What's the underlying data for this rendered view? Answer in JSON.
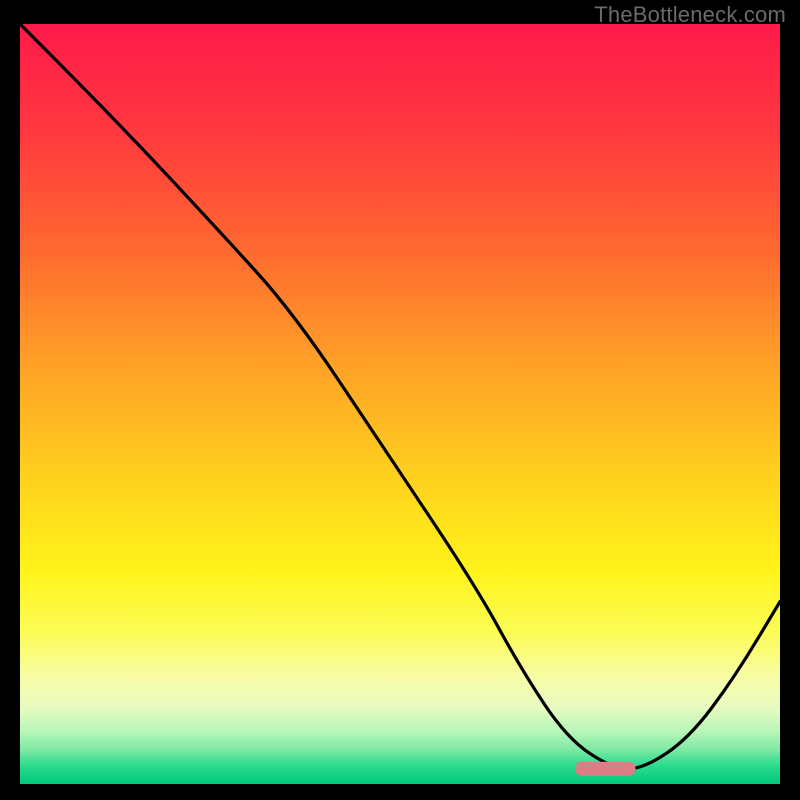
{
  "watermark": "TheBottleneck.com",
  "chart_data": {
    "type": "line",
    "title": "",
    "xlabel": "",
    "ylabel": "",
    "xlim": [
      0,
      100
    ],
    "ylim": [
      0,
      100
    ],
    "grid": false,
    "legend": false,
    "series": [
      {
        "name": "curve",
        "x": [
          0,
          12,
          26,
          36,
          48,
          60,
          66,
          72,
          78,
          82,
          88,
          94,
          100
        ],
        "y": [
          100,
          88,
          73,
          62,
          44,
          26,
          15,
          6,
          2,
          2,
          6,
          14,
          24
        ]
      }
    ],
    "marker": {
      "name": "optimum-region",
      "x_start": 73,
      "x_end": 81,
      "y": 2,
      "color": "#dd7c84"
    },
    "gradient_stops": [
      {
        "offset": 0.0,
        "color": "#ff1a4b"
      },
      {
        "offset": 0.15,
        "color": "#ff3a3e"
      },
      {
        "offset": 0.3,
        "color": "#ff6a2f"
      },
      {
        "offset": 0.45,
        "color": "#ffa227"
      },
      {
        "offset": 0.6,
        "color": "#ffd21e"
      },
      {
        "offset": 0.72,
        "color": "#fff31a"
      },
      {
        "offset": 0.8,
        "color": "#fcfc55"
      },
      {
        "offset": 0.86,
        "color": "#f8fca6"
      },
      {
        "offset": 0.9,
        "color": "#e6fbc0"
      },
      {
        "offset": 0.93,
        "color": "#b9f7b9"
      },
      {
        "offset": 0.955,
        "color": "#7ce9a3"
      },
      {
        "offset": 0.975,
        "color": "#2edc8e"
      },
      {
        "offset": 1.0,
        "color": "#00c97c"
      }
    ]
  }
}
